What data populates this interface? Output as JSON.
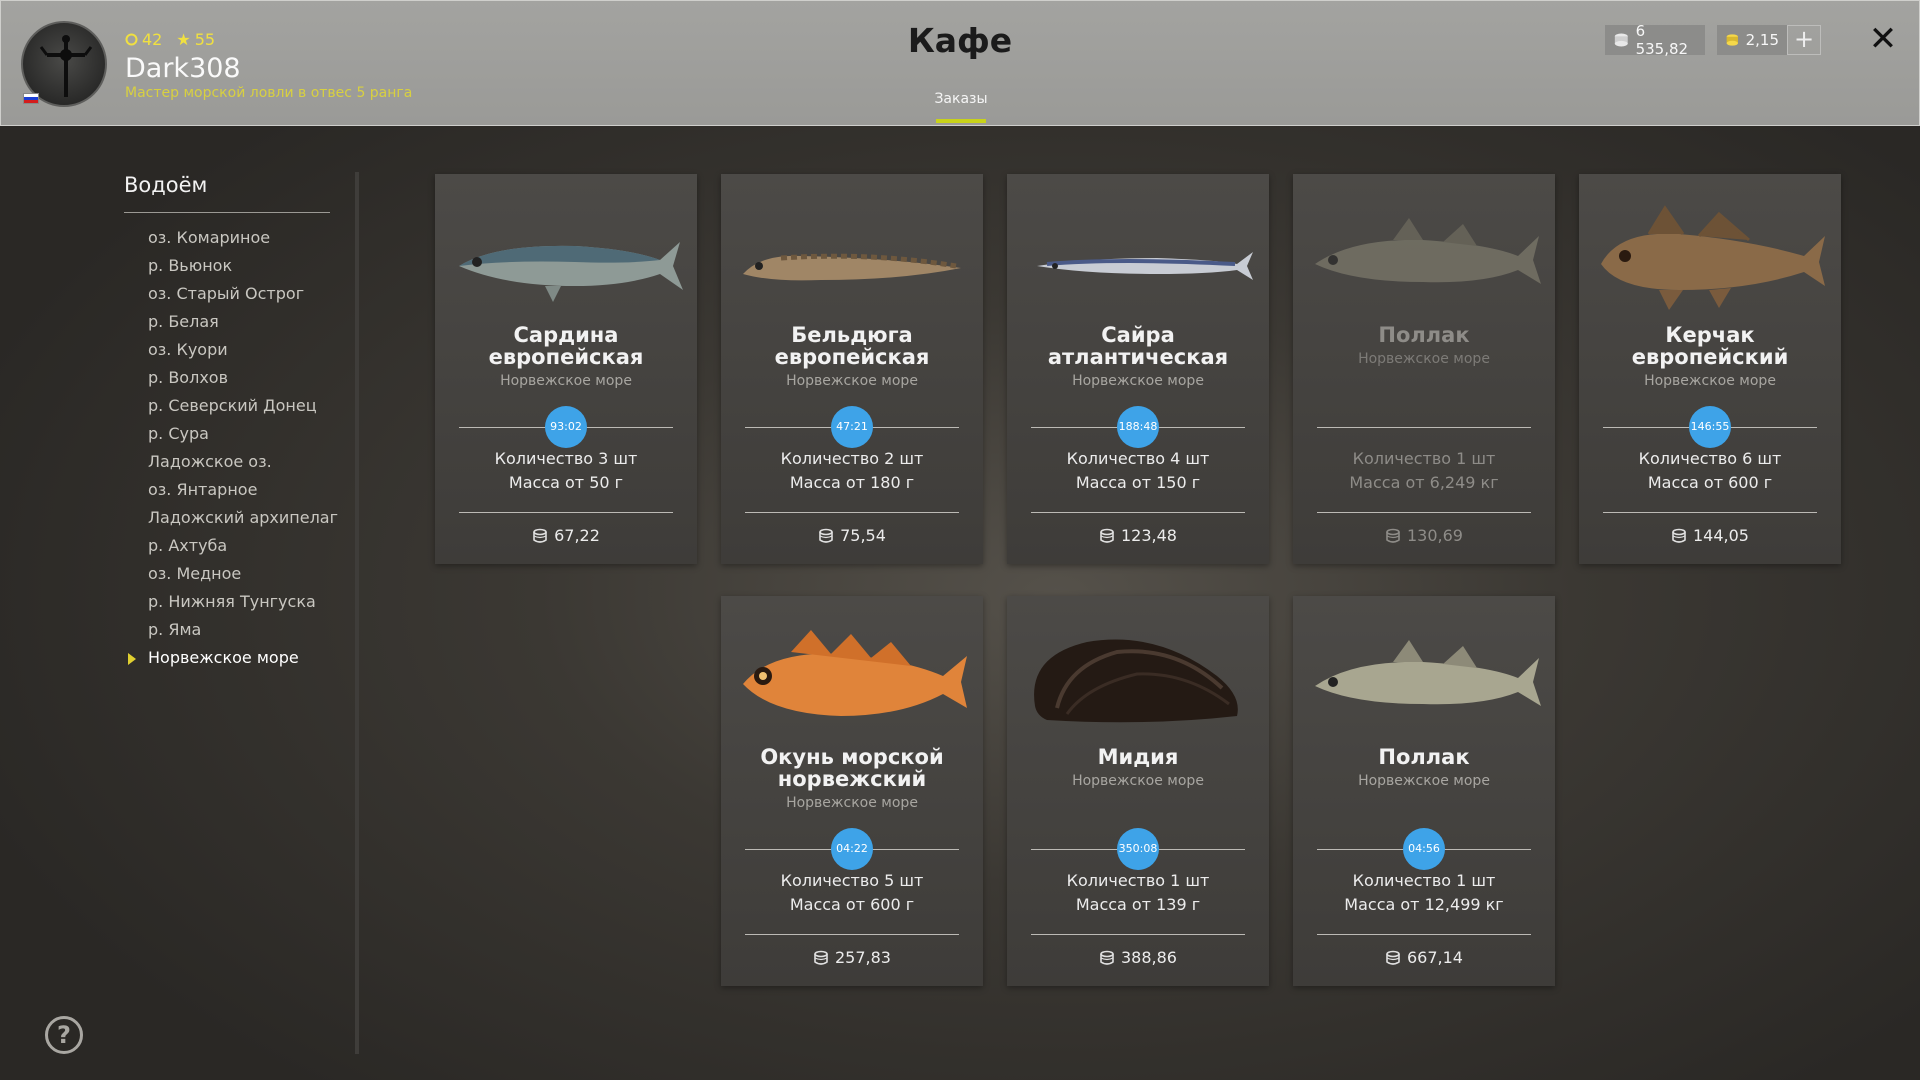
{
  "header": {
    "title": "Кафе",
    "tab_label": "Заказы",
    "player": {
      "level_points": "42",
      "stars": "55",
      "name": "Dark308",
      "rank": "Мастер морской ловли в отвес 5 ранга"
    },
    "silver": "6 535,82",
    "gold": "2,15",
    "plus_label": "+",
    "close_label": "✕"
  },
  "sidebar": {
    "title": "Водоём",
    "items": [
      "оз. Комариное",
      "р. Вьюнок",
      "оз. Старый Острог",
      "р. Белая",
      "оз. Куори",
      "р. Волхов",
      "р. Северский Донец",
      "р. Сура",
      "Ладожское оз.",
      "оз. Янтарное",
      "Ладожский архипелаг",
      "р. Ахтуба",
      "оз. Медное",
      "р. Нижняя Тунгуска",
      "р. Яма",
      "Норвежское море"
    ],
    "active_index": 15,
    "help_label": "?"
  },
  "cards": [
    {
      "name": "Сардина европейская",
      "location": "Норвежское море",
      "timer": "93:02",
      "quantity": "Количество 3 шт",
      "mass": "Масса от 50 г",
      "price": "67,22",
      "icon": "sardine-image"
    },
    {
      "name": "Бельдюга европейская",
      "location": "Норвежское море",
      "timer": "47:21",
      "quantity": "Количество 2 шт",
      "mass": "Масса от 180 г",
      "price": "75,54",
      "icon": "eelpout-image"
    },
    {
      "name": "Сайра атлантическая",
      "location": "Норвежское море",
      "timer": "188:48",
      "quantity": "Количество 4 шт",
      "mass": "Масса от 150 г",
      "price": "123,48",
      "icon": "saury-image"
    },
    {
      "name": "Поллак",
      "location": "Норвежское море",
      "timer": "",
      "quantity": "Количество 1 шт",
      "mass": "Масса от 6,249 кг",
      "price": "130,69",
      "icon": "pollack-image"
    },
    {
      "name": "Керчак европейский",
      "location": "Норвежское море",
      "timer": "146:55",
      "quantity": "Количество 6 шт",
      "mass": "Масса от 600 г",
      "price": "144,05",
      "icon": "sculpin-image"
    },
    {
      "name": "Окунь морской норвежский",
      "location": "Норвежское море",
      "timer": "04:22",
      "quantity": "Количество 5 шт",
      "mass": "Масса от 600 г",
      "price": "257,83",
      "icon": "redfish-image"
    },
    {
      "name": "Мидия",
      "location": "Норвежское море",
      "timer": "350:08",
      "quantity": "Количество 1 шт",
      "mass": "Масса от 139 г",
      "price": "388,86",
      "icon": "mussel-image"
    },
    {
      "name": "Поллак",
      "location": "Норвежское море",
      "timer": "04:56",
      "quantity": "Количество 1 шт",
      "mass": "Масса от 12,499 кг",
      "price": "667,14",
      "icon": "pollack-image"
    }
  ],
  "colors": {
    "accent_underline": "#c8d21a",
    "timer_badge": "#3ea3e8",
    "rank_text": "#d8d040"
  }
}
